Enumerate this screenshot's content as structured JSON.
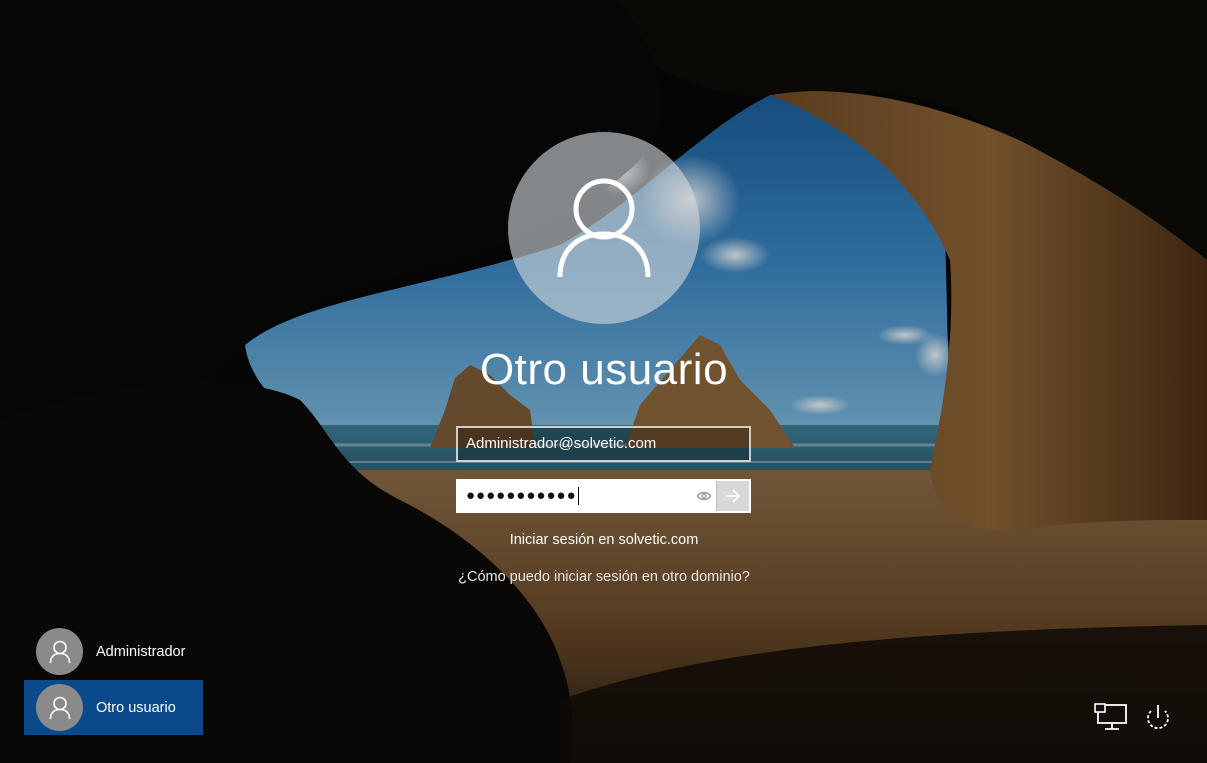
{
  "login": {
    "display_name": "Otro usuario",
    "username_value": "Administrador@solvetic.com",
    "password_mask": "●●●●●●●●●●●",
    "sign_in_to": "Iniciar sesión en solvetic.com",
    "other_domain_link": "¿Cómo puedo iniciar sesión en otro dominio?"
  },
  "user_list": {
    "items": [
      {
        "label": "Administrador",
        "selected": false
      },
      {
        "label": "Otro usuario",
        "selected": true
      }
    ]
  },
  "system_icons": [
    "network-icon",
    "power-icon"
  ],
  "colors": {
    "selected_user": "#0a4a8a",
    "avatar_bg": "#c8ccd2",
    "submit_bg": "#d8d8d8"
  }
}
